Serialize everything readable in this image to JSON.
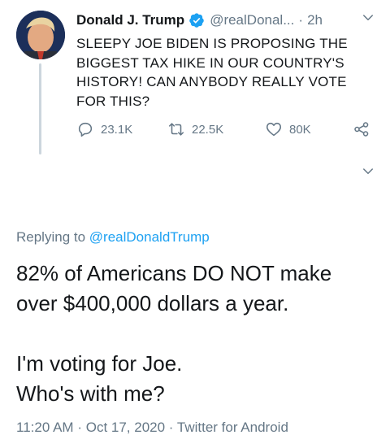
{
  "parent_tweet": {
    "author_name": "Donald J. Trump",
    "handle": "@realDonal...",
    "separator": "·",
    "time": "2h",
    "lines": [
      "SLEEPY JOE BIDEN IS PROPOSING THE",
      "BIGGEST TAX HIKE IN OUR COUNTRY'S",
      "HISTORY! CAN ANYBODY REALLY VOTE",
      "FOR THIS?"
    ],
    "reply_count": "23.1K",
    "retweet_count": "22.5K",
    "like_count": "80K"
  },
  "reply": {
    "replying_prefix": "Replying to",
    "replying_to": "@realDonaldTrump",
    "paragraph1": [
      "82% of Americans DO NOT make",
      "over $400,000 dollars a year."
    ],
    "paragraph2": [
      "I'm voting for Joe.",
      "Who's with me?"
    ],
    "time": "11:20 AM",
    "separator1": "·",
    "date": "Oct 17, 2020",
    "separator2": "·",
    "source": "Twitter for Android"
  },
  "colors": {
    "accent": "#1da1f2",
    "secondary_text": "#657786",
    "primary_text": "#14171a",
    "thread_line": "#ccd6dd"
  },
  "icons": [
    "verified-badge-icon",
    "chevron-down-icon",
    "reply-icon",
    "retweet-icon",
    "like-icon",
    "share-icon"
  ]
}
